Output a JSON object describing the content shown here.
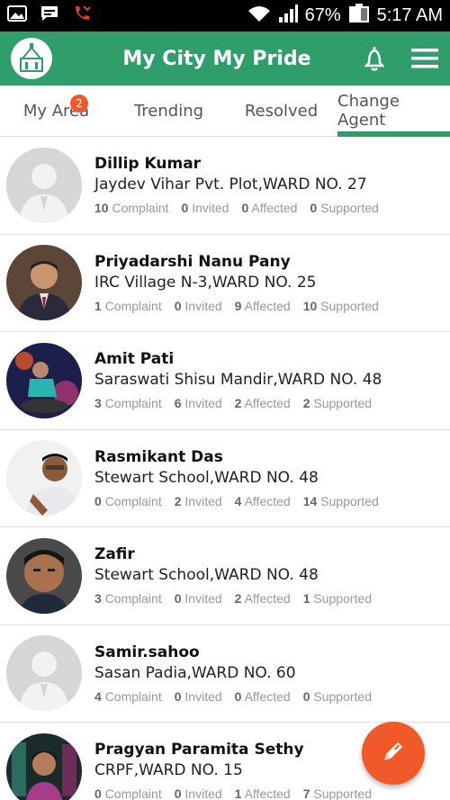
{
  "status_bar": {
    "battery": "67%",
    "time": "5:17 AM",
    "icons": [
      "image-icon",
      "message-icon",
      "missed-call-icon",
      "wifi-icon",
      "signal-icon",
      "battery-icon"
    ]
  },
  "app_bar": {
    "title": "My City My Pride",
    "logo_icon": "city-logo-icon",
    "actions": [
      "bell-icon",
      "menu-icon"
    ],
    "brand_color": "#2f9e6b"
  },
  "tabs": [
    {
      "label": "My Area",
      "badge": "2",
      "active": false
    },
    {
      "label": "Trending",
      "active": false
    },
    {
      "label": "Resolved",
      "active": false
    },
    {
      "label": "Change Agent",
      "active": true
    }
  ],
  "agents": [
    {
      "name": "Dillip Kumar",
      "address": "Jaydev Vihar Pvt. Plot,WARD NO. 27",
      "complaint": "10",
      "invited": "0",
      "affected": "0",
      "supported": "0",
      "avatar": "placeholder"
    },
    {
      "name": "Priyadarshi Nanu Pany",
      "address": "IRC Village N-3,WARD NO. 25",
      "complaint": "1",
      "invited": "0",
      "affected": "9",
      "supported": "10",
      "avatar": "photo"
    },
    {
      "name": "Amit Pati",
      "address": "Saraswati Shisu Mandir,WARD NO. 48",
      "complaint": "3",
      "invited": "6",
      "affected": "2",
      "supported": "2",
      "avatar": "photo"
    },
    {
      "name": "Rasmikant Das",
      "address": "Stewart School,WARD NO. 48",
      "complaint": "0",
      "invited": "2",
      "affected": "4",
      "supported": "14",
      "avatar": "photo"
    },
    {
      "name": "Zafir",
      "address": "Stewart School,WARD NO. 48",
      "complaint": "3",
      "invited": "0",
      "affected": "2",
      "supported": "1",
      "avatar": "photo"
    },
    {
      "name": "Samir.sahoo",
      "address": "Sasan Padia,WARD NO. 60",
      "complaint": "4",
      "invited": "0",
      "affected": "0",
      "supported": "0",
      "avatar": "placeholder"
    },
    {
      "name": "Pragyan Paramita Sethy",
      "address": "CRPF,WARD NO. 15",
      "complaint": "0",
      "invited": "0",
      "affected": "1",
      "supported": "7",
      "avatar": "photo"
    }
  ],
  "stat_labels": {
    "complaint": "Complaint",
    "invited": "Invited",
    "affected": "Affected",
    "supported": "Supported"
  },
  "fab": {
    "icon": "pencil-icon",
    "color": "#f05a28"
  }
}
